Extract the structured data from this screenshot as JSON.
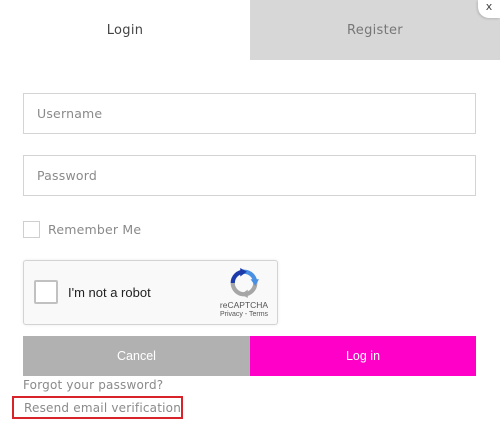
{
  "tabs": [
    {
      "label": "Login",
      "active": true
    },
    {
      "label": "Register",
      "active": false
    }
  ],
  "close_label": "x",
  "form": {
    "username_placeholder": "Username",
    "password_placeholder": "Password",
    "remember_label": "Remember Me",
    "remember_checked": false
  },
  "recaptcha": {
    "label": "I'm not a robot",
    "brand": "reCAPTCHA",
    "links": "Privacy - Terms",
    "logo_icon": "recaptcha-logo-icon"
  },
  "buttons": {
    "cancel_label": "Cancel",
    "login_label": "Log in"
  },
  "links": {
    "forgot_password": "Forgot your password?",
    "resend_verification": "Resend email verification"
  },
  "colors": {
    "accent": "#ff00c8",
    "cancel": "#b1b1b1",
    "inactive_tab": "#d7d7d7",
    "highlight_border": "#d8232a"
  }
}
